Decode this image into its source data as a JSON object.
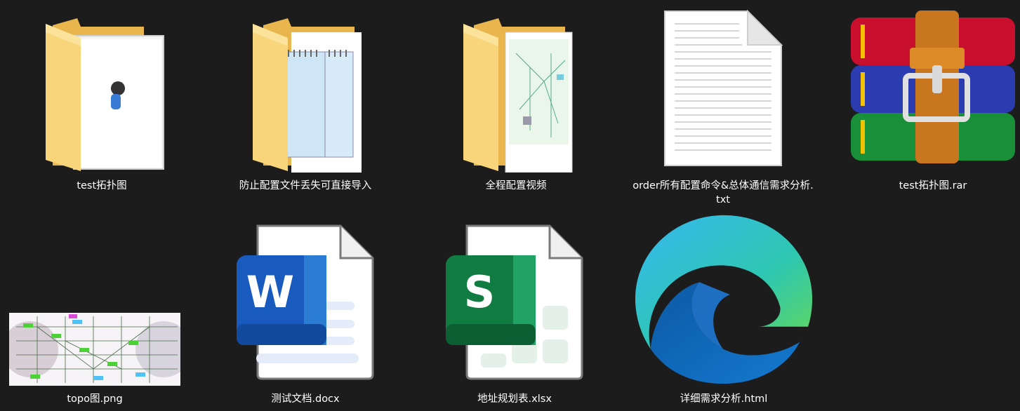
{
  "files": [
    {
      "name": "test拓扑图",
      "type": "folder-image-icon"
    },
    {
      "name": "防止配置文件丢失可直接导入",
      "type": "folder-notepad-icon"
    },
    {
      "name": "全程配置视频",
      "type": "folder-diagram-icon"
    },
    {
      "name": "order所有配置命令&总体通信需求分析.txt",
      "type": "text-file-icon"
    },
    {
      "name": "test拓扑图.rar",
      "type": "winrar-archive-icon"
    },
    {
      "name": "topo图.png",
      "type": "image-thumbnail"
    },
    {
      "name": "测试文档.docx",
      "type": "word-document-icon"
    },
    {
      "name": "地址规划表.xlsx",
      "type": "excel-spreadsheet-icon"
    },
    {
      "name": "详细需求分析.html",
      "type": "edge-browser-icon"
    }
  ],
  "colors": {
    "background": "#1c1c1c",
    "folder": "#f7d174",
    "word": "#185abd",
    "excel": "#107c41",
    "winrar_red": "#c8102e",
    "winrar_blue": "#2b3bb0",
    "winrar_green": "#1a8f3a"
  }
}
